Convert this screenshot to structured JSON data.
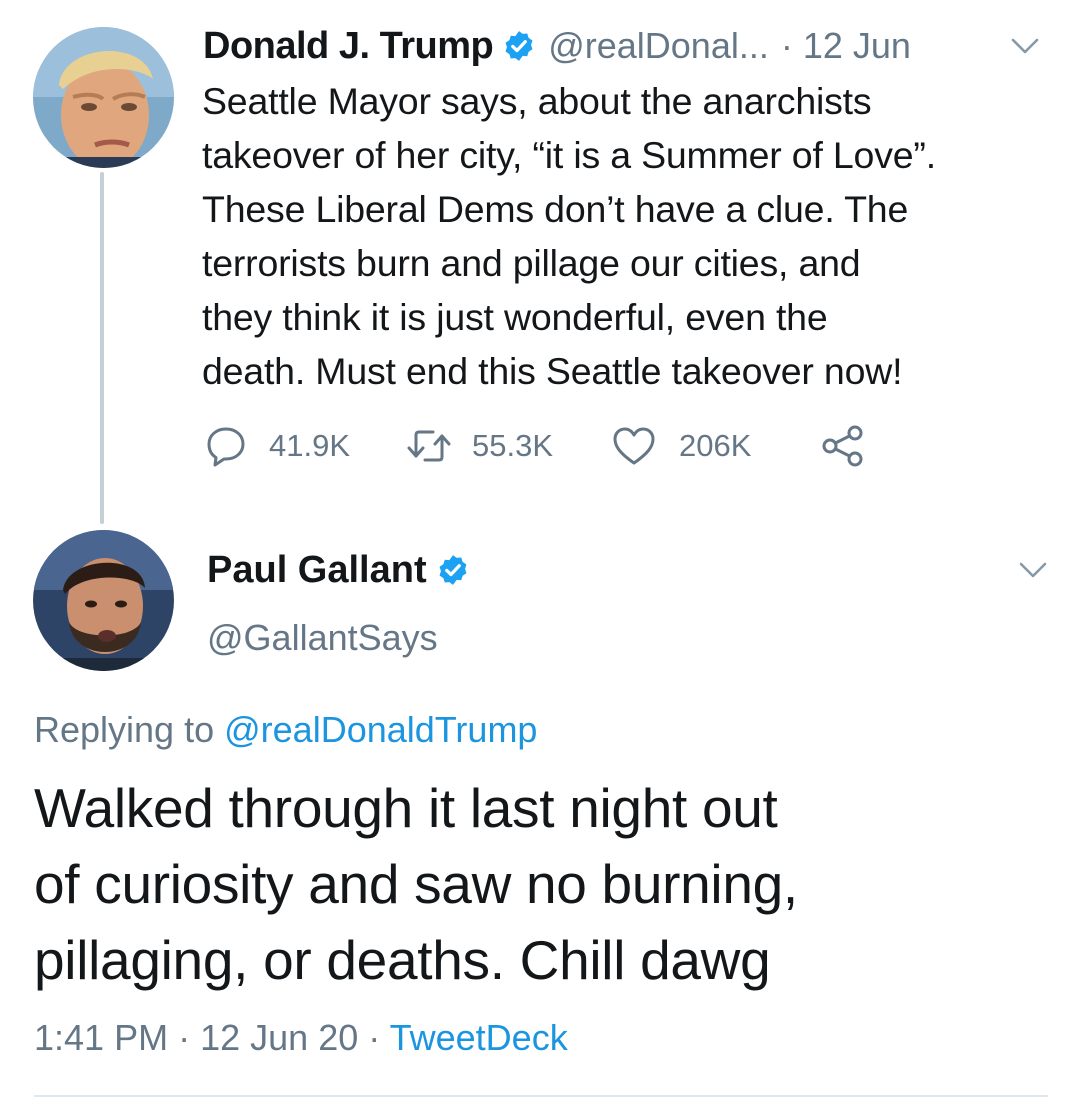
{
  "colors": {
    "text": "#14171a",
    "secondary": "#657786",
    "link": "#1b95e0",
    "verified_badge": "#1da1f2",
    "thread_line": "#c4cfd6",
    "divider": "#e1e8ed"
  },
  "original_tweet": {
    "display_name": "Donald J. Trump",
    "handle": "@realDonal...",
    "separator": "·",
    "date": "12 Jun",
    "text": "Seattle Mayor says, about the anarchists\ntakeover of her city, “it is a Summer of Love”.\nThese Liberal Dems don’t have a clue. The\nterrorists burn and pillage our cities, and\nthey think it is just wonderful, even the\ndeath. Must end this Seattle takeover now!",
    "replies": "41.9K",
    "retweets": "55.3K",
    "likes": "206K",
    "icons": {
      "reply": "reply-icon",
      "retweet": "retweet-icon",
      "like": "heart-icon",
      "share": "share-icon",
      "menu": "chevron-down-icon",
      "badge": "verified-badge-icon"
    }
  },
  "reply_tweet": {
    "display_name": "Paul Gallant",
    "handle": "@GallantSays",
    "replying_prefix": "Replying to",
    "replying_to": "@realDonaldTrump",
    "text": "Walked through it last night out\nof curiosity and saw no burning,\npillaging, or deaths. Chill dawg",
    "time": "1:41 PM",
    "sep1": "·",
    "date": "12 Jun 20",
    "sep2": "·",
    "source": "TweetDeck"
  }
}
